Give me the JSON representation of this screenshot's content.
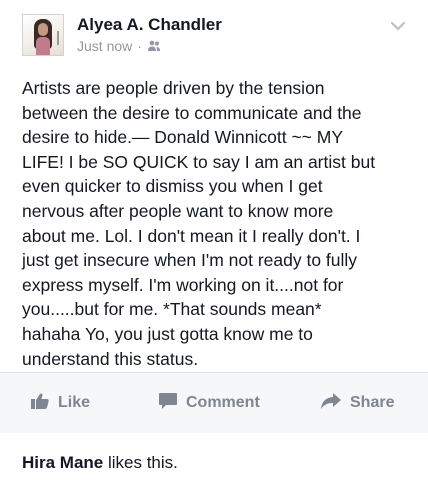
{
  "post": {
    "author": "Alyea A. Chandler",
    "timestamp": "Just now",
    "separator": "·",
    "audience_icon": "friends-icon",
    "menu_icon": "chevron-down-icon",
    "text": "Artists are people driven by the tension\nbetween the desire to communicate and the\ndesire to hide.— Donald Winnicott ~~ MY\nLIFE! I be SO QUICK to say I am an artist but\neven quicker to dismiss you when I get\nnervous after people want to know more\nabout me. Lol. I don't mean it I really don't. I\njust get insecure when I'm not ready to fully\nexpress myself. I'm working on it....not for\nyou.....but for me. *That sounds mean*\nhahaha Yo, you just gotta know me to\nunderstand this status."
  },
  "actions": {
    "like_label": "Like",
    "comment_label": "Comment",
    "share_label": "Share",
    "like_icon": "thumbs-up-icon",
    "comment_icon": "comment-icon",
    "share_icon": "share-arrow-icon"
  },
  "likes": {
    "liker": "Hira Mane",
    "suffix": " likes this."
  },
  "colors": {
    "background": "#e9eaed",
    "card": "#ffffff",
    "action_bar": "#f6f7f8",
    "action_text": "#7f8591",
    "meta_text": "#9197a3",
    "body_text": "#141823"
  }
}
